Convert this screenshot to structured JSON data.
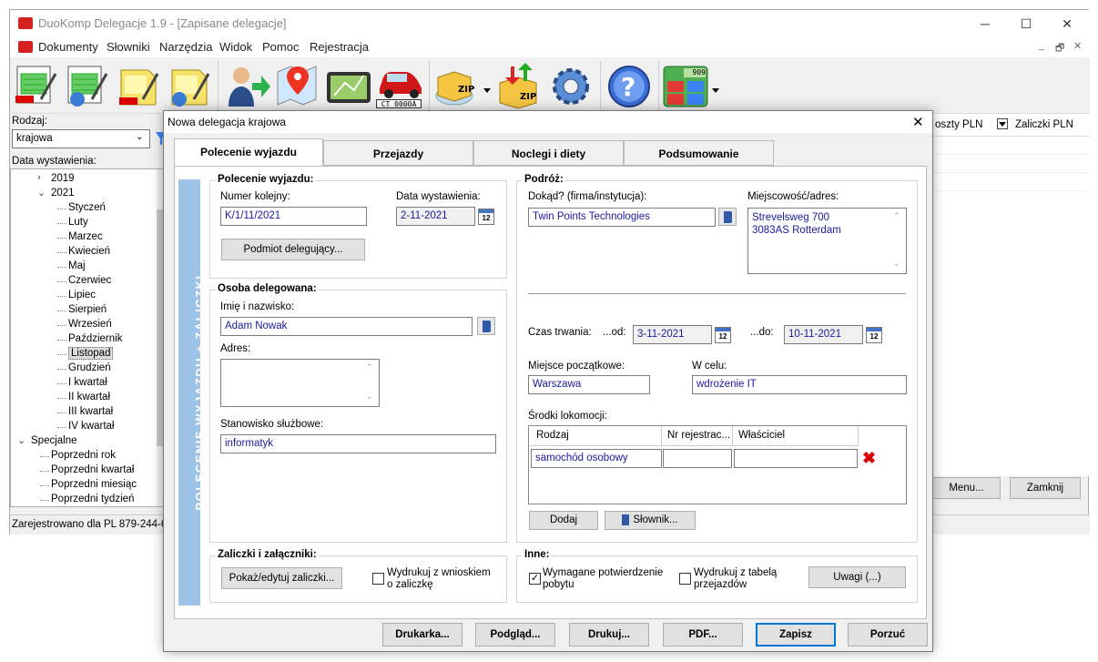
{
  "window": {
    "title": "DuoKomp Delegacje 1.9 - [Zapisane delegacje]",
    "min": "─",
    "max": "☐",
    "close": "✕"
  },
  "menu": [
    "Dokumenty",
    "Słowniki",
    "Narzędzia",
    "Widok",
    "Pomoc",
    "Rejestracja"
  ],
  "mdi_controls": [
    "_",
    "🗗",
    "✕"
  ],
  "toolbar": {
    "car_plate": "CT 0000A",
    "calc_display": "909"
  },
  "left": {
    "rodzaj_label": "Rodzaj:",
    "rodzaj_value": "krajowa",
    "data_label": "Data wystawienia:",
    "tree": [
      {
        "text": "2019",
        "indent": 1,
        "toggle": "›"
      },
      {
        "text": "2021",
        "indent": 1,
        "toggle": "⌄"
      },
      {
        "text": "Styczeń",
        "indent": 2
      },
      {
        "text": "Luty",
        "indent": 2
      },
      {
        "text": "Marzec",
        "indent": 2
      },
      {
        "text": "Kwiecień",
        "indent": 2
      },
      {
        "text": "Maj",
        "indent": 2
      },
      {
        "text": "Czerwiec",
        "indent": 2
      },
      {
        "text": "Lipiec",
        "indent": 2
      },
      {
        "text": "Sierpień",
        "indent": 2
      },
      {
        "text": "Wrzesień",
        "indent": 2
      },
      {
        "text": "Październik",
        "indent": 2
      },
      {
        "text": "Listopad",
        "indent": 2,
        "selected": true
      },
      {
        "text": "Grudzień",
        "indent": 2
      },
      {
        "text": "I kwartał",
        "indent": 2
      },
      {
        "text": "II kwartał",
        "indent": 2
      },
      {
        "text": "III kwartał",
        "indent": 2
      },
      {
        "text": "IV kwartał",
        "indent": 2
      },
      {
        "text": "Specjalne",
        "indent": 0,
        "toggle": "⌄"
      },
      {
        "text": "Poprzedni rok",
        "indent": 1
      },
      {
        "text": "Poprzedni kwartał",
        "indent": 1
      },
      {
        "text": "Poprzedni miesiąc",
        "indent": 1
      },
      {
        "text": "Poprzedni tydzień",
        "indent": 1
      }
    ]
  },
  "right": {
    "col1": "oszty PLN",
    "col2": "Zaliczki PLN",
    "menu_btn": "Menu...",
    "close_btn": "Zamknij"
  },
  "status": "Zarejestrowano dla PL 879-244-6",
  "dialog": {
    "title": "Nowa delegacja krajowa",
    "tabs": [
      "Polecenie wyjazdu",
      "Przejazdy",
      "Noclegi i diety",
      "Podsumowanie"
    ],
    "band": "POLECENIE WYJAZDU + ZALICZKI",
    "polecenie": {
      "title": "Polecenie wyjazdu:",
      "nr_label": "Numer kolejny:",
      "nr_value": "K/1/11/2021",
      "data_label": "Data wystawienia:",
      "data_value": "2-11-2021",
      "podmiot_btn": "Podmiot delegujący..."
    },
    "osoba": {
      "title": "Osoba delegowana:",
      "imie_label": "Imię i nazwisko:",
      "imie_value": "Adam Nowak",
      "adres_label": "Adres:",
      "adres_value": "",
      "stan_label": "Stanowisko służbowe:",
      "stan_value": "informatyk"
    },
    "podroz": {
      "title": "Podróż:",
      "dokad_label": "Dokąd? (firma/instytucja):",
      "dokad_value": "Twin Points Technologies",
      "miejsc_label": "Miejscowość/adres:",
      "miejsc_line1": "Strevelsweg 700",
      "miejsc_line2": "3083AS Rotterdam",
      "czas_label": "Czas trwania:",
      "od_label": "...od:",
      "od_value": "3-11-2021",
      "do_label": "...do:",
      "do_value": "10-11-2021",
      "pocz_label": "Miejsce początkowe:",
      "pocz_value": "Warszawa",
      "cel_label": "W celu:",
      "cel_value": "wdrożenie IT",
      "srodki_label": "Środki lokomocji:",
      "cols": [
        "Rodzaj",
        "Nr rejestrac...",
        "Właściciel"
      ],
      "row": [
        "samochód osobowy",
        "",
        ""
      ],
      "dodaj_btn": "Dodaj",
      "slownik_btn": "Słownik..."
    },
    "zaliczki": {
      "title": "Zaliczki i załączniki:",
      "pokaz_btn": "Pokaż/edytuj zaliczki...",
      "wydruk_label1": "Wydrukuj z wnioskiem",
      "wydruk_label2": "o zaliczkę",
      "wydruk_checked": false
    },
    "inne": {
      "title": "Inne:",
      "wym_label1": "Wymagane potwierdzenie",
      "wym_label2": "pobytu",
      "wym_checked": true,
      "tab_label1": "Wydrukuj z tabelą",
      "tab_label2": "przejazdów",
      "tab_checked": false,
      "uwagi_btn": "Uwagi (...)"
    },
    "buttons": [
      "Drukarka...",
      "Podgląd...",
      "Drukuj...",
      "PDF...",
      "Zapisz",
      "Porzuć"
    ]
  }
}
